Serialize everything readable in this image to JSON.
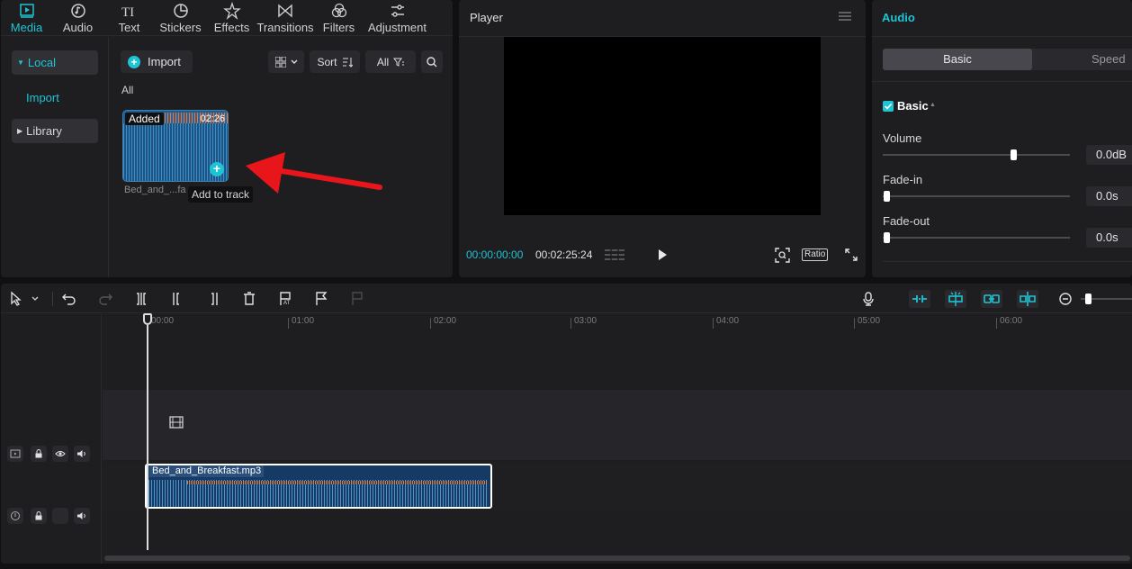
{
  "media_tabs": [
    {
      "label": "Media",
      "icon": "media-icon"
    },
    {
      "label": "Audio",
      "icon": "audio-icon"
    },
    {
      "label": "Text",
      "icon": "text-icon"
    },
    {
      "label": "Stickers",
      "icon": "stickers-icon"
    },
    {
      "label": "Effects",
      "icon": "effects-icon"
    },
    {
      "label": "Transitions",
      "icon": "transitions-icon"
    },
    {
      "label": "Filters",
      "icon": "filters-icon"
    },
    {
      "label": "Adjustment",
      "icon": "adjustment-icon"
    }
  ],
  "media_sidebar": {
    "local": "Local",
    "import": "Import",
    "library": "Library"
  },
  "media_toolbar": {
    "import": "Import",
    "sort": "Sort",
    "all": "All"
  },
  "media_section": "All",
  "media_item": {
    "badge": "Added",
    "duration": "02:26",
    "name": "Bed_and_...fa",
    "tooltip": "Add to track"
  },
  "player": {
    "title": "Player",
    "current_time": "00:00:00:00",
    "total_time": "00:02:25:24",
    "ratio": "Ratio"
  },
  "audio_panel": {
    "title": "Audio",
    "tabs": [
      "Basic",
      "Speed"
    ],
    "section": "Basic",
    "volume_label": "Volume",
    "volume_value": "0.0dB",
    "volume_level": 0.7,
    "fadein_label": "Fade-in",
    "fadein_value": "0.0s",
    "fadeout_label": "Fade-out",
    "fadeout_value": "0.0s"
  },
  "timeline": {
    "ruler": [
      "00:00",
      "01:00",
      "02:00",
      "03:00",
      "04:00",
      "05:00",
      "06:00"
    ],
    "clip_name": "Bed_and_Breakfast.mp3"
  },
  "colors": {
    "accent": "#1fc4d4",
    "clip": "#173a64",
    "arrow": "#e8151b"
  }
}
